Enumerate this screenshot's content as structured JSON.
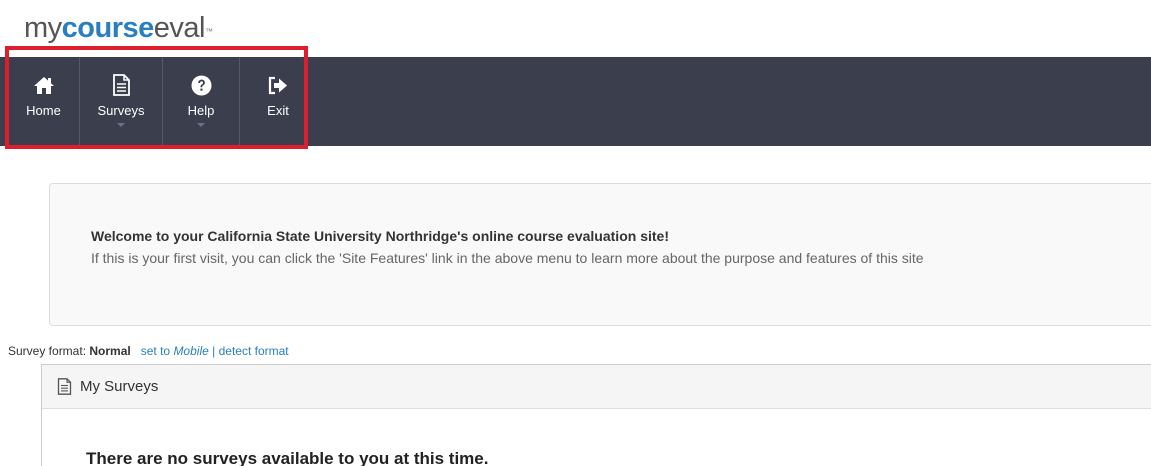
{
  "logo": {
    "part1": "my",
    "part2": "course",
    "part3": "eval",
    "trademark": "™"
  },
  "nav": {
    "items": [
      {
        "label": "Home",
        "icon": "home-icon"
      },
      {
        "label": "Surveys",
        "icon": "document-icon"
      },
      {
        "label": "Help",
        "icon": "question-circle-icon"
      },
      {
        "label": "Exit",
        "icon": "sign-out-icon"
      }
    ]
  },
  "welcome": {
    "title": "Welcome to your California State University Northridge's online course evaluation site!",
    "text": "If this is your first visit, you can click the 'Site Features' link in the above menu to learn more about the purpose and features of this site"
  },
  "format": {
    "label": "Survey format:",
    "current": "Normal",
    "set_prefix": "set to",
    "set_target": "Mobile",
    "separator": "|",
    "detect": "detect format"
  },
  "surveys": {
    "header": "My Surveys",
    "icon": "document-icon",
    "empty_message": "There are no surveys available to you at this time."
  },
  "colors": {
    "navbar": "#3b3e4c",
    "accent": "#2a7fc1",
    "highlight": "#dc1e2d"
  }
}
